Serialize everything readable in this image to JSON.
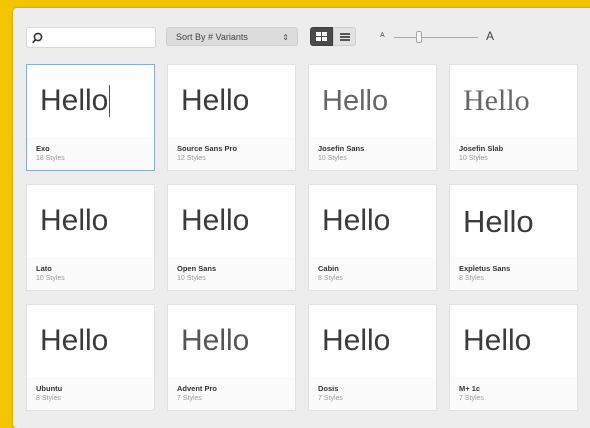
{
  "toolbar": {
    "search_placeholder": "",
    "sort_label": "Sort By # Variants",
    "size_small_label": "A",
    "size_large_label": "A",
    "size_slider_value": 0.3
  },
  "preview_text": "Hello",
  "fonts": [
    {
      "name": "Exo",
      "styles": "18 Styles",
      "selected": true
    },
    {
      "name": "Source Sans Pro",
      "styles": "12 Styles"
    },
    {
      "name": "Josefin Sans",
      "styles": "10 Styles"
    },
    {
      "name": "Josefin Slab",
      "styles": "10 Styles"
    },
    {
      "name": "Lato",
      "styles": "10 Styles"
    },
    {
      "name": "Open Sans",
      "styles": "10 Styles"
    },
    {
      "name": "Cabin",
      "styles": "8 Styles"
    },
    {
      "name": "Expletus Sans",
      "styles": "8 Styles"
    },
    {
      "name": "Ubuntu",
      "styles": "8 Styles"
    },
    {
      "name": "Advent Pro",
      "styles": "7 Styles"
    },
    {
      "name": "Dosis",
      "styles": "7 Styles"
    },
    {
      "name": "M+ 1c",
      "styles": "7 Styles"
    }
  ],
  "colors": {
    "background": "#f3c400",
    "panel": "#ededed",
    "selected_border": "#8aaed3",
    "active_toggle": "#4a4a4a"
  }
}
